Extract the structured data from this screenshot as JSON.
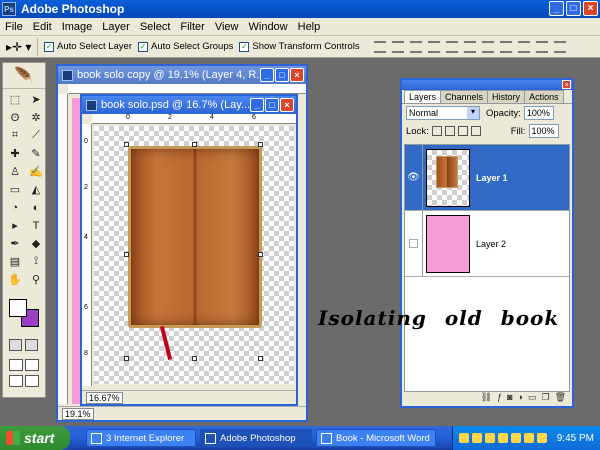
{
  "app": {
    "title": "Adobe Photoshop",
    "logo": "Ps"
  },
  "window_controls": {
    "minimize": "_",
    "maximize": "□",
    "close": "×"
  },
  "menu": [
    "File",
    "Edit",
    "Image",
    "Layer",
    "Select",
    "Filter",
    "View",
    "Window",
    "Help"
  ],
  "options": {
    "tool_icon": "▸✛ ▾",
    "auto_select_layer": "Auto Select Layer",
    "auto_select_groups": "Auto Select Groups",
    "show_transform_controls": "Show Transform Controls",
    "checkmark": "✓"
  },
  "doc_back": {
    "title": "book solo copy @ 19.1% (Layer 4, R...",
    "zoom": "19.1%"
  },
  "doc_front": {
    "title": "book solo.psd @ 16.7% (Lay...",
    "zoom": "16.67%",
    "ruler_h": [
      "0",
      "2",
      "4",
      "6"
    ],
    "ruler_v": [
      "0",
      "2",
      "4",
      "6",
      "8"
    ]
  },
  "layers_palette": {
    "tabs": [
      "Layers",
      "Channels",
      "History",
      "Actions"
    ],
    "blend_mode": "Normal",
    "opacity_label": "Opacity:",
    "opacity_value": "100%",
    "lock_label": "Lock:",
    "fill_label": "Fill:",
    "fill_value": "100%",
    "layers": [
      {
        "name": "Layer 1",
        "visible": true
      },
      {
        "name": "Layer 2",
        "visible": false
      }
    ],
    "eye_glyph": "👁"
  },
  "overlay_caption": "Isolating old book",
  "taskbar": {
    "start_label": "start",
    "items": [
      "3 Internet Explorer",
      "Adobe Photoshop",
      "Book - Microsoft Word"
    ],
    "clock": "9:45 PM"
  },
  "colors": {
    "foreground": "#ffffff",
    "background": "#9b3fc4",
    "pink_layer": "#f59ad6",
    "xp_blue": "#245edb"
  }
}
